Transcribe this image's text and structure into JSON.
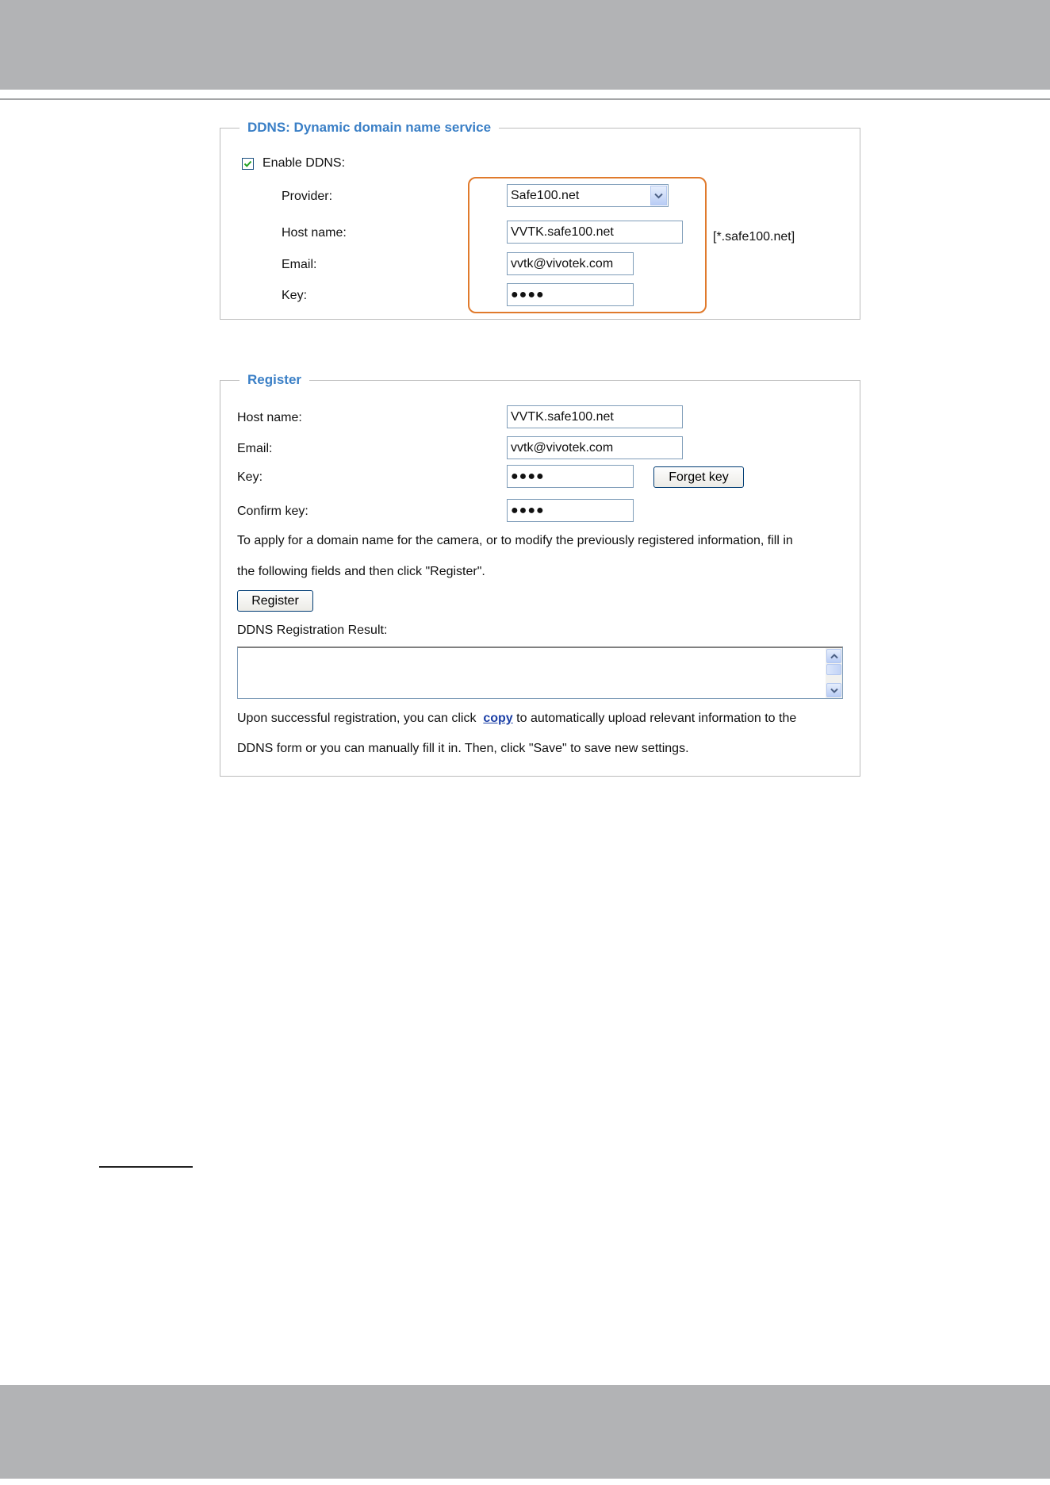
{
  "ddns": {
    "legend": "DDNS: Dynamic domain name service",
    "enable_label": "Enable DDNS:",
    "enable_checked": true,
    "provider_label": "Provider:",
    "provider_value": "Safe100.net",
    "hostname_label": "Host name:",
    "hostname_value": "VVTK.safe100.net",
    "hostname_suffix": "[*.safe100.net]",
    "email_label": "Email:",
    "email_value": "vvtk@vivotek.com",
    "key_label": "Key:",
    "key_value": "●●●●"
  },
  "register": {
    "legend": "Register",
    "hostname_label": "Host name:",
    "hostname_value": "VVTK.safe100.net",
    "email_label": "Email:",
    "email_value": "vvtk@vivotek.com",
    "key_label": "Key:",
    "key_value": "●●●●",
    "forget_key_button": "Forget key",
    "confirm_key_label": "Confirm key:",
    "confirm_key_value": "●●●●",
    "instructions_line1": "To apply for a domain name for the camera, or to modify the previously registered information, fill in",
    "instructions_line2": "the following fields and then click \"Register\".",
    "register_button": "Register",
    "result_label": "DDNS Registration Result:",
    "result_value": "",
    "note_line1_before": "Upon successful registration, you can click",
    "note_link": "copy",
    "note_line1_after": "to automatically upload relevant information to the",
    "note_line2": "DDNS form or you can manually fill it in. Then, click \"Save\" to save new settings."
  },
  "colors": {
    "accent": "#3a7fc6",
    "highlight": "#e07a2c",
    "link": "#1b3fa6"
  }
}
